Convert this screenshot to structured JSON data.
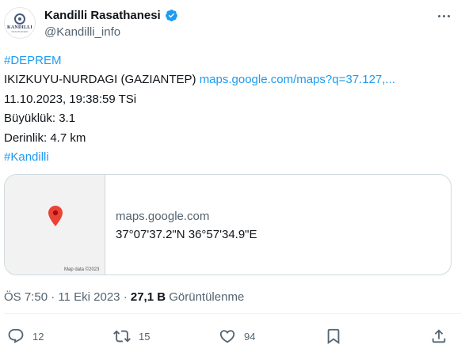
{
  "tweet": {
    "author": {
      "display_name": "Kandilli Rasathanesi",
      "handle": "@Kandilli_info",
      "avatar_text_1": "KANDILLI",
      "avatar_text_2": "RASATHANESI"
    },
    "hashtag_1": "#DEPREM",
    "location": "IKIZKUYU-NURDAGI (GAZIANTEP)",
    "location_link": "maps.google.com/maps?q=37.127,...",
    "datetime": "11.10.2023, 19:38:59 TSi",
    "magnitude": "Büyüklük: 3.1",
    "depth": "Derinlik: 4.7 km",
    "hashtag_2": "#Kandilli"
  },
  "card": {
    "domain": "maps.google.com",
    "coordinates": "37°07'37.2\"N 36°57'34.9\"E",
    "map_credit": "Map data ©2023"
  },
  "meta": {
    "time": "ÖS 7:50",
    "separator": "·",
    "date": "11 Eki 2023",
    "views_count": "27,1 B",
    "views_label": "Görüntülenme"
  },
  "actions": {
    "replies": "12",
    "retweets": "15",
    "likes": "94"
  },
  "colors": {
    "link": "#1d9bf0",
    "verified": "#1d9bf0",
    "pin": "#ea4335",
    "muted": "#536471"
  },
  "icons": [
    "verified-badge-icon",
    "more-icon",
    "map-pin-icon",
    "reply-icon",
    "retweet-icon",
    "like-icon",
    "bookmark-icon",
    "share-icon"
  ]
}
